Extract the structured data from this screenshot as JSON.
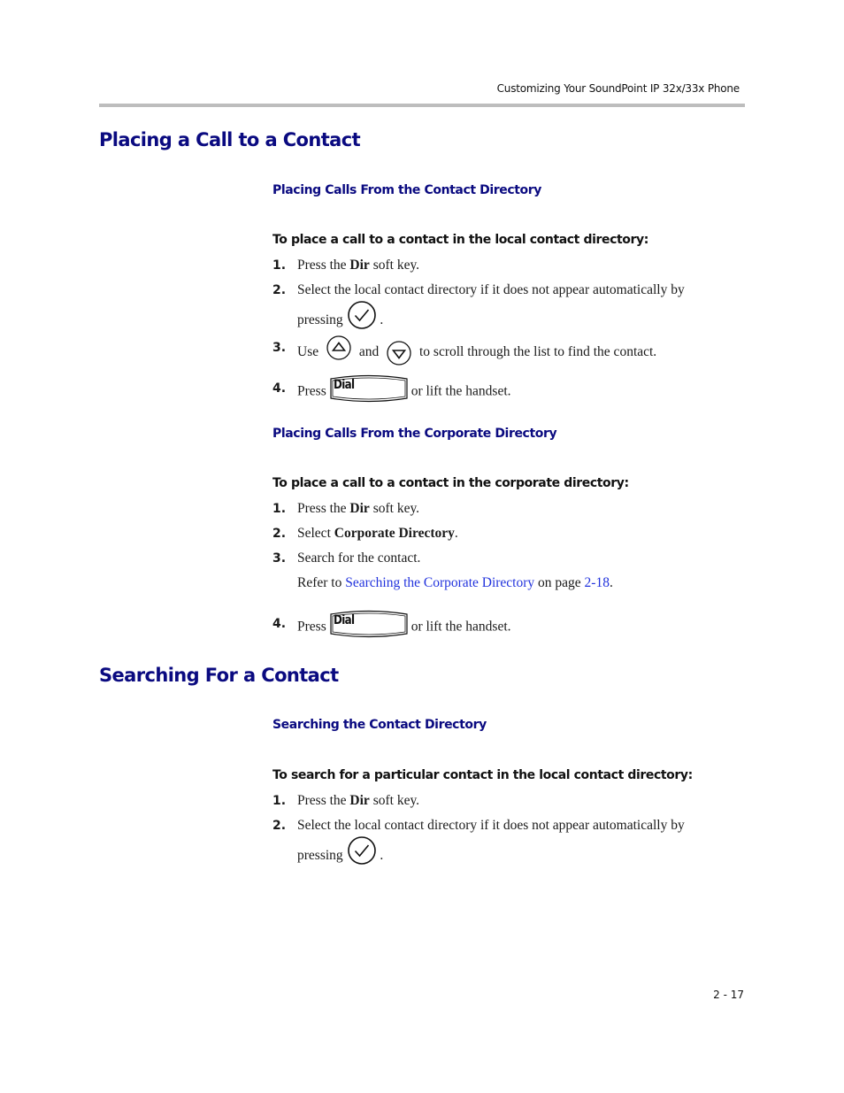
{
  "header": {
    "running_title": "Customizing Your SoundPoint IP 32x/33x Phone",
    "rule_color": "#bdbdbd"
  },
  "sections": [
    {
      "title": "Placing a Call to a Contact",
      "subsections": [
        {
          "title": "Placing Calls From the Contact Directory",
          "procedure_title": "To place a call to a contact in the local contact directory:",
          "steps": [
            {
              "num": "1.",
              "pre": "Press the ",
              "bold": "Dir",
              "post": " soft key."
            },
            {
              "num": "2.",
              "text": "Select the local contact directory if it does not appear automatically by",
              "cont_pre": "pressing",
              "icon": "check-key-icon",
              "cont_post": "."
            },
            {
              "num": "3.",
              "pre": "Use",
              "icon1": "up-arrow-key-icon",
              "mid": "and",
              "icon2": "down-arrow-key-icon",
              "post": "to scroll through the list to find the contact."
            },
            {
              "num": "4.",
              "pre": "Press",
              "key_label": "Dial",
              "post": "or lift the handset."
            }
          ]
        },
        {
          "title": "Placing Calls From the Corporate Directory",
          "procedure_title": "To place a call to a contact in the corporate directory:",
          "steps": [
            {
              "num": "1.",
              "pre": "Press the ",
              "bold": "Dir",
              "post": " soft key."
            },
            {
              "num": "2.",
              "pre": "Select ",
              "bold": "Corporate Directory",
              "post": "."
            },
            {
              "num": "3.",
              "text": "Search for the contact.",
              "ref_pre": "Refer to ",
              "ref_link": "Searching the Corporate Directory",
              "ref_mid": " on page ",
              "ref_page": "2-18",
              "ref_post": "."
            },
            {
              "num": "4.",
              "pre": "Press",
              "key_label": "Dial",
              "post": "or lift the handset."
            }
          ]
        }
      ]
    },
    {
      "title": "Searching For a Contact",
      "subsections": [
        {
          "title": "Searching the Contact Directory",
          "procedure_title": "To search for a particular contact in the local contact directory:",
          "steps": [
            {
              "num": "1.",
              "pre": "Press the ",
              "bold": "Dir",
              "post": " soft key."
            },
            {
              "num": "2.",
              "text": "Select the local contact directory if it does not appear automatically by",
              "cont_pre": "pressing",
              "icon": "check-key-icon",
              "cont_post": "."
            }
          ]
        }
      ]
    }
  ],
  "footer": {
    "page_number": "2 - 17"
  },
  "colors": {
    "heading": "#0a0a80",
    "link": "#2233dd",
    "text": "#1a1a1a"
  }
}
